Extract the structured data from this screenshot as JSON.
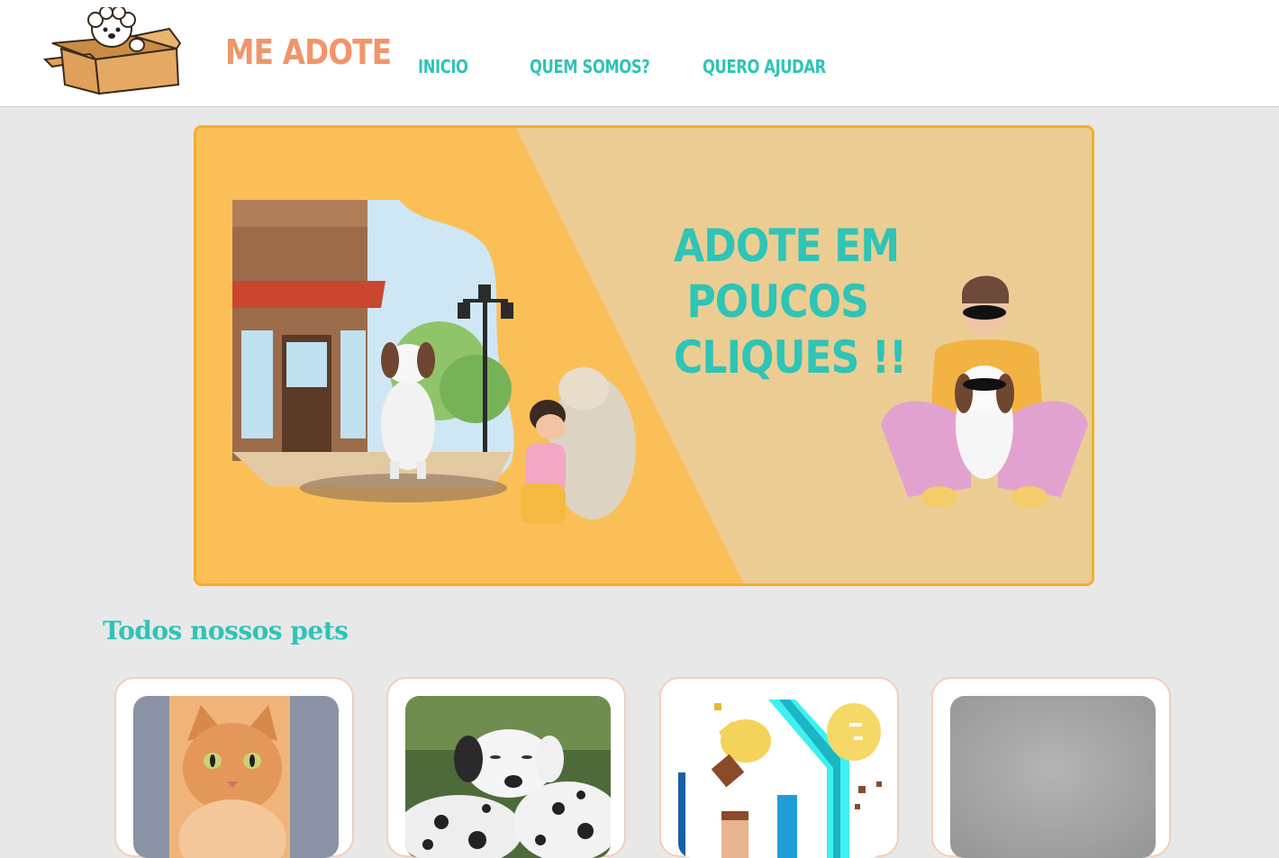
{
  "header": {
    "brand": "ME ADOTE",
    "nav": [
      {
        "label": "INICIO"
      },
      {
        "label": "QUEM SOMOS?"
      },
      {
        "label": "QUERO AJUDAR"
      }
    ]
  },
  "banner": {
    "headline": "ADOTE EM\n POUCOS\nCLIQUES !!"
  },
  "pets": {
    "title": "Todos nossos pets",
    "cards": [
      {
        "image": "orange-cat-photo"
      },
      {
        "image": "dalmatian-puppies-photo"
      },
      {
        "image": "cleaning-tools-illustration"
      },
      {
        "image": "gray-placeholder-photo"
      }
    ]
  },
  "colors": {
    "brand": "#f0956a",
    "accent": "#2ec4b6",
    "banner_bg": "#fbbf57",
    "banner_border": "#f6ac2c",
    "page_bg": "#e8e8e8"
  }
}
